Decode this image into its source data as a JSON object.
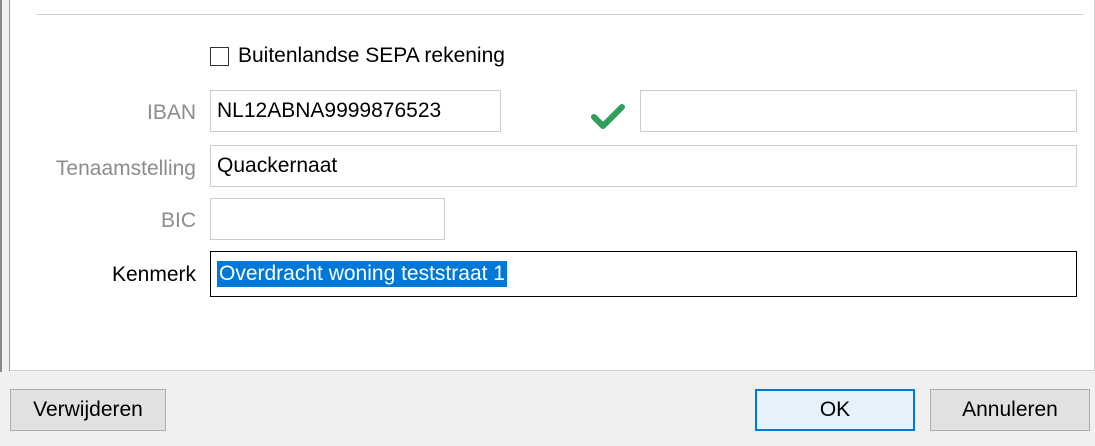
{
  "form": {
    "foreign_sepa": {
      "label": "Buitenlandse SEPA rekening",
      "checked": false
    },
    "iban": {
      "label": "IBAN",
      "value": "NL12ABNA9999876523",
      "extra_value": "",
      "valid": true
    },
    "tenaamstelling": {
      "label": "Tenaamstelling",
      "value": "Quackernaat"
    },
    "bic": {
      "label": "BIC",
      "value": ""
    },
    "kenmerk": {
      "label": "Kenmerk",
      "value": "Overdracht woning teststraat 1"
    }
  },
  "buttons": {
    "delete": "Verwijderen",
    "ok": "OK",
    "cancel": "Annuleren"
  },
  "colors": {
    "valid_check": "#2e9e5b",
    "selection": "#0078d7"
  },
  "icons": {
    "iban_valid": "check-icon"
  }
}
